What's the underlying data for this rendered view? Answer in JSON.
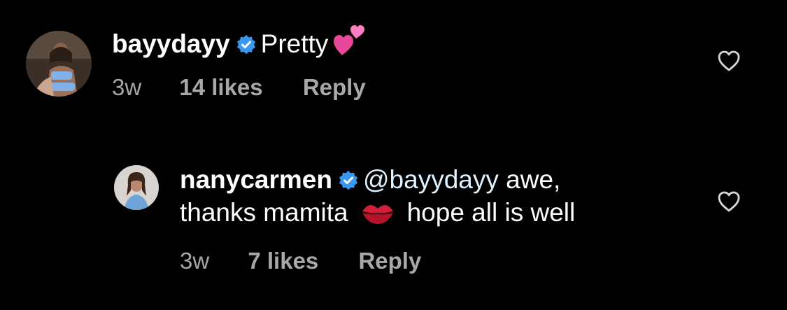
{
  "comments": [
    {
      "username": "bayydayy",
      "verified": true,
      "text": "Pretty",
      "emoji": "two-hearts",
      "time": "3w",
      "likes": "14 likes",
      "reply_label": "Reply"
    },
    {
      "username": "nanycarmen",
      "verified": true,
      "mention": "@bayydayy",
      "text_line1": "awe,",
      "text_line2_a": "thanks mamita",
      "emoji": "kiss-mark",
      "text_line2_b": "hope all is well",
      "time": "3w",
      "likes": "7 likes",
      "reply_label": "Reply"
    }
  ],
  "colors": {
    "background": "#000000",
    "text": "#ffffff",
    "meta": "#a8a8a8",
    "verified": "#3897f0",
    "mention": "#e0f1ff"
  },
  "icons": {
    "verified": "verified-badge-icon",
    "like": "heart-outline-icon"
  }
}
